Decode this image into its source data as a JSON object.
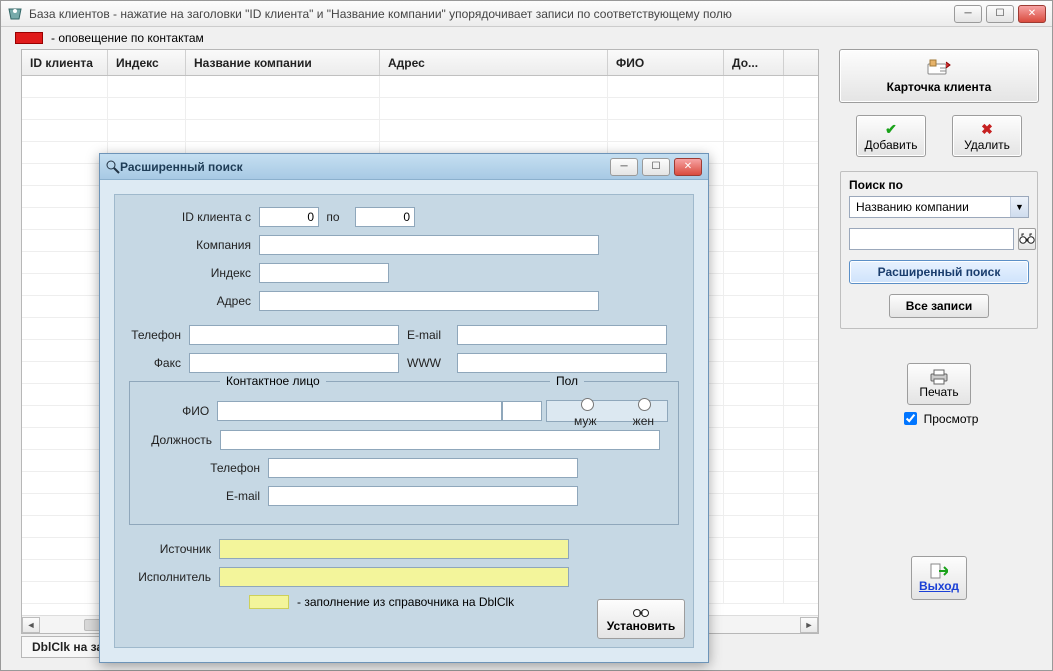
{
  "window": {
    "title": "База клиентов - нажатие на заголовки \"ID клиента\" и \"Название компании\" упорядочивает записи по соответствующему полю"
  },
  "legend": {
    "text": "- оповещение по контактам"
  },
  "table": {
    "columns": [
      "ID клиента",
      "Индекс",
      "Название компании",
      "Адрес",
      "ФИО",
      "До..."
    ],
    "widths": [
      86,
      78,
      194,
      228,
      116,
      60
    ]
  },
  "hint_bar": "DblClk на запись вызывает карточку клиента",
  "side": {
    "client_card": "Карточка клиента",
    "add": "Добавить",
    "delete": "Удалить",
    "search_group_title": "Поиск по",
    "search_combo": "Названию компании",
    "ext_search": "Расширенный поиск",
    "all_records": "Все записи",
    "print": "Печать",
    "preview": "Просмотр",
    "exit": "Выход"
  },
  "dialog": {
    "title": "Расширенный поиск",
    "id_from_label": "ID клиента с",
    "id_from_value": "0",
    "id_to_label": "по",
    "id_to_value": "0",
    "company_label": "Компания",
    "index_label": "Индекс",
    "address_label": "Адрес",
    "phone_label": "Телефон",
    "email_label": "E-mail",
    "fax_label": "Факс",
    "www_label": "WWW",
    "contact_legend": "Контактное лицо",
    "fio_label": "ФИО",
    "pol_label": "Пол",
    "gender_m": "муж",
    "gender_f": "жен",
    "position_label": "Должность",
    "contact_phone_label": "Телефон",
    "contact_email_label": "E-mail",
    "source_label": "Источник",
    "executor_label": "Исполнитель",
    "hint": "- заполнение из справочника на DblClk",
    "apply": "Установить"
  }
}
